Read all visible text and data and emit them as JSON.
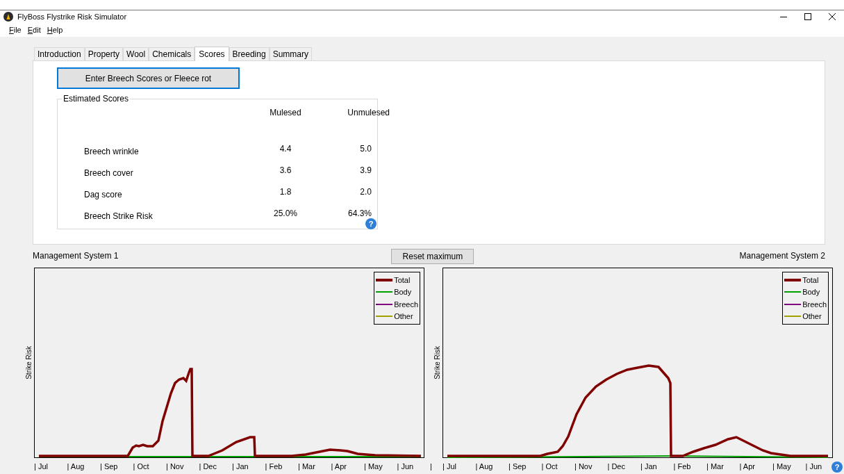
{
  "window": {
    "title": "FlyBoss Flystrike Risk Simulator"
  },
  "menu": [
    "File",
    "Edit",
    "Help"
  ],
  "tabs": [
    {
      "label": "Introduction",
      "selected": false
    },
    {
      "label": "Property",
      "selected": false
    },
    {
      "label": "Wool",
      "selected": false
    },
    {
      "label": "Chemicals",
      "selected": false
    },
    {
      "label": "Scores",
      "selected": true
    },
    {
      "label": "Breeding",
      "selected": false
    },
    {
      "label": "Summary",
      "selected": false
    }
  ],
  "enter_button": "Enter Breech Scores or Fleece rot",
  "estimated_scores": {
    "title": "Estimated Scores",
    "columns": [
      "Mulesed",
      "Unmulesed"
    ],
    "rows": [
      {
        "label": "Breech wrinkle",
        "mulesed": "4.4",
        "unmulesed": "5.0"
      },
      {
        "label": "Breech cover",
        "mulesed": "3.6",
        "unmulesed": "3.9"
      },
      {
        "label": "Dag score",
        "mulesed": "1.8",
        "unmulesed": "2.0"
      },
      {
        "label": "Breech Strike Risk",
        "mulesed": "25.0%",
        "unmulesed": "64.3%"
      }
    ]
  },
  "reset_button": "Reset maximum",
  "help_icons": [
    "?",
    "?"
  ],
  "charts": [
    {
      "title": "Management System 1",
      "ylabel": "Strike Risk",
      "legend": [
        {
          "name": "Total",
          "color": "#800000"
        },
        {
          "name": "Body",
          "color": "#00a000"
        },
        {
          "name": "Breech",
          "color": "#800080"
        },
        {
          "name": "Other",
          "color": "#a0a000"
        }
      ],
      "months": [
        "| Jul",
        "| Aug",
        "| Sep",
        "| Oct",
        "| Nov",
        "| Dec",
        "| Jan",
        "| Feb",
        "| Mar",
        "| Apr",
        "| May",
        "| Jun",
        "|"
      ]
    },
    {
      "title": "Management System 2",
      "ylabel": "Strike Risk",
      "legend": [
        {
          "name": "Total",
          "color": "#800000"
        },
        {
          "name": "Body",
          "color": "#00a000"
        },
        {
          "name": "Breech",
          "color": "#800080"
        },
        {
          "name": "Other",
          "color": "#a0a000"
        }
      ],
      "months": [
        "| Jul",
        "| Aug",
        "| Sep",
        "| Oct",
        "| Nov",
        "| Dec",
        "| Jan",
        "| Feb",
        "| Mar",
        "| Apr",
        "| May",
        "| Jun"
      ]
    }
  ]
}
